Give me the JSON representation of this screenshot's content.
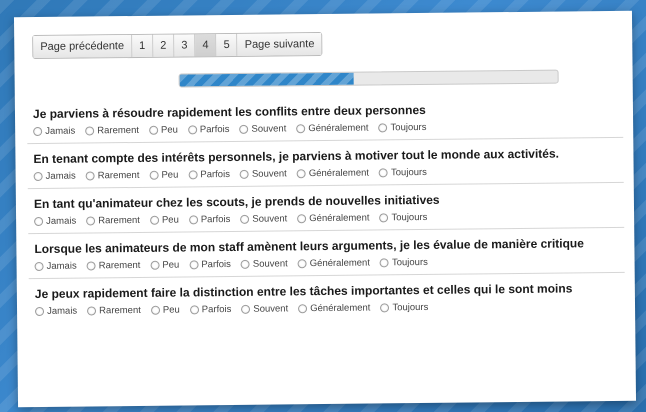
{
  "pager": {
    "prev_label": "Page précédente",
    "pages": [
      "1",
      "2",
      "3",
      "4",
      "5"
    ],
    "active_page": "4",
    "next_label": "Page suivante"
  },
  "progress": {
    "percent": 46,
    "fill_color": "#2f86c9"
  },
  "options": [
    "Jamais",
    "Rarement",
    "Peu",
    "Parfois",
    "Souvent",
    "Généralement",
    "Toujours"
  ],
  "questions": [
    {
      "text": "Je parviens à résoudre rapidement les conflits entre deux personnes"
    },
    {
      "text": "En tenant compte des intérêts personnels, je parviens à motiver tout le monde aux activités."
    },
    {
      "text": "En tant qu'animateur chez les scouts, je prends de nouvelles initiatives"
    },
    {
      "text": "Lorsque les animateurs de mon staff amènent leurs arguments, je les évalue de manière critique"
    },
    {
      "text": "Je peux rapidement faire la distinction entre les tâches importantes et celles qui le sont moins"
    }
  ]
}
